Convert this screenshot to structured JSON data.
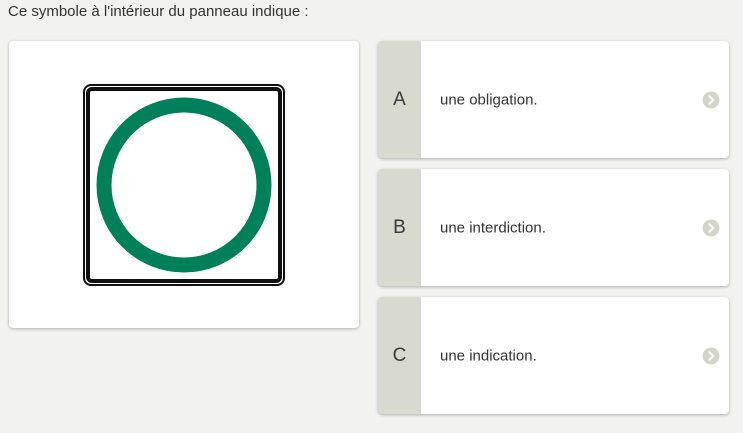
{
  "question": {
    "text": "Ce symbole à l'intérieur du panneau indique :"
  },
  "sign": {
    "description_icon": "green-ring-sign-icon",
    "ring_color": "#00805a",
    "border_color": "#111111",
    "background_color": "#ffffff"
  },
  "answers": [
    {
      "letter": "A",
      "text": "une obligation.",
      "icon": "chevron-right-icon"
    },
    {
      "letter": "B",
      "text": "une interdiction.",
      "icon": "chevron-right-icon"
    },
    {
      "letter": "C",
      "text": "une indication.",
      "icon": "chevron-right-icon"
    }
  ],
  "colors": {
    "page_background": "#f2f2f1",
    "letter_box": "#d8d9cf",
    "chevron": "#d5d6ca"
  }
}
